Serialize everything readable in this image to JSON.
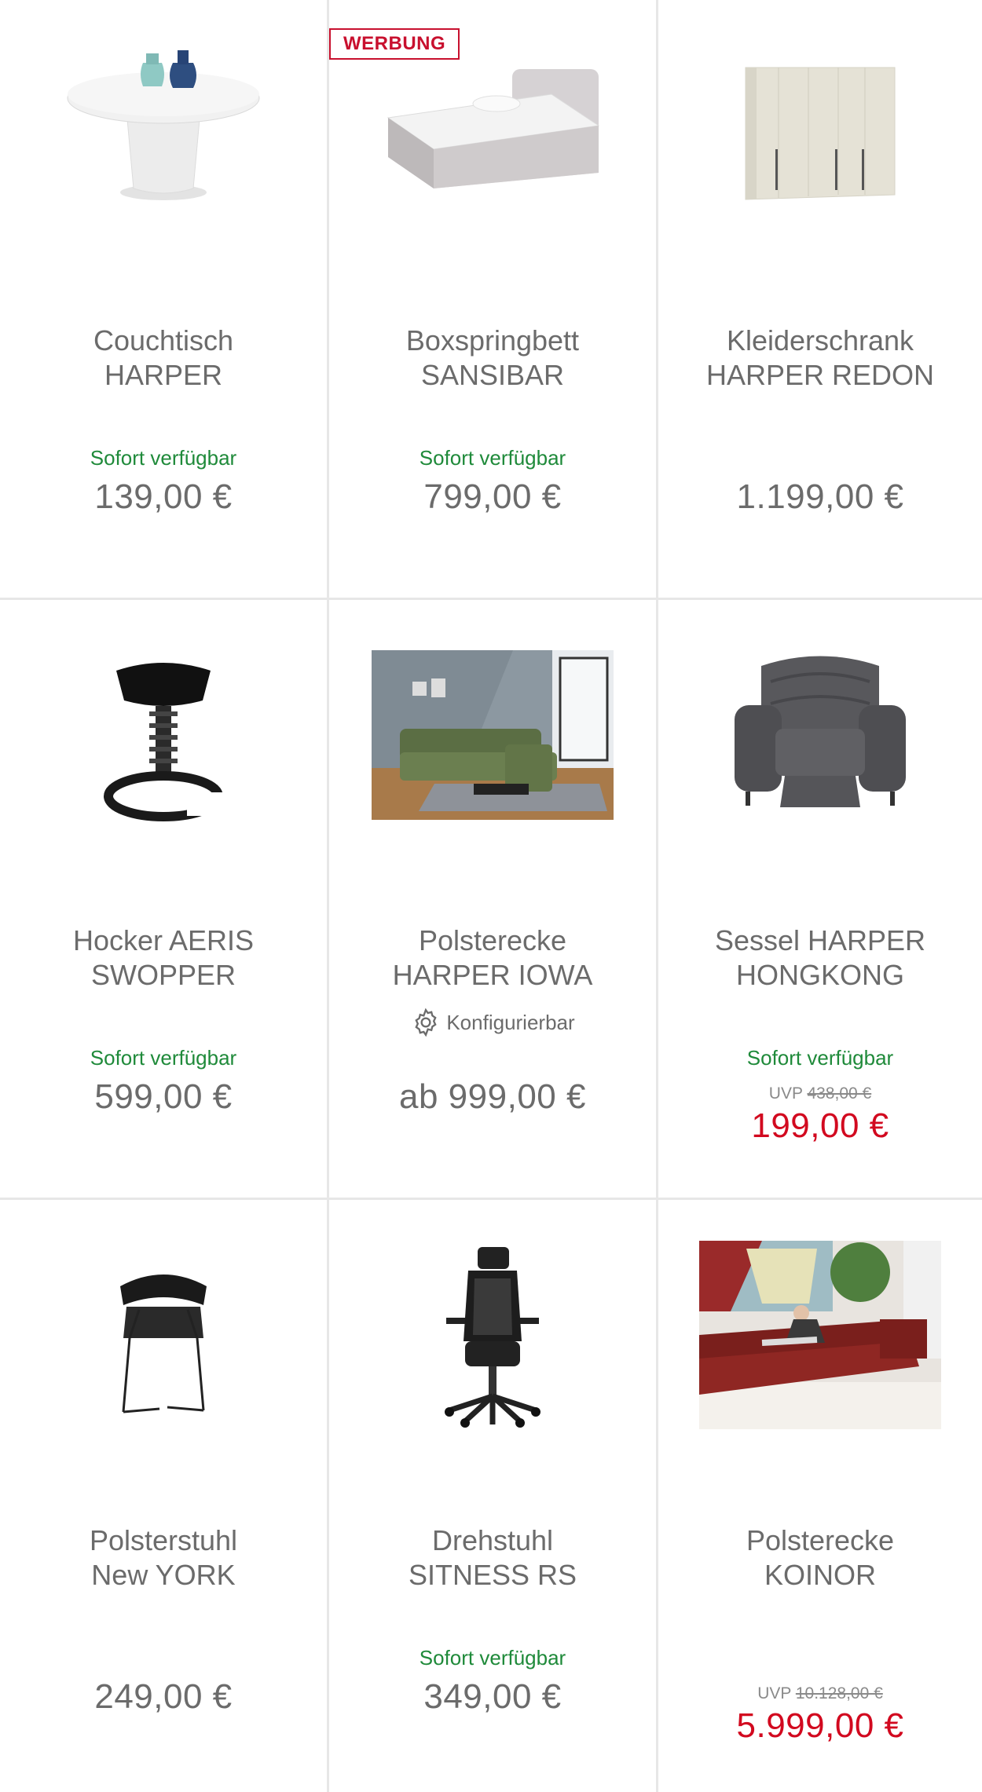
{
  "colors": {
    "available": "#1f8a3a",
    "sale": "#d2091f",
    "text": "#6b6b6b",
    "badge": "#c8102e"
  },
  "products": [
    {
      "title1": "Couchtisch",
      "title2": "HARPER",
      "availability": "Sofort verfügbar",
      "price": "139,00 €"
    },
    {
      "badge": "WERBUNG",
      "title1": "Boxspringbett",
      "title2": "SANSIBAR",
      "availability": "Sofort verfügbar",
      "price": "799,00 €"
    },
    {
      "title1": "Kleiderschrank",
      "title2": "HARPER REDON",
      "price": "1.199,00 €"
    },
    {
      "title1": "Hocker AERIS",
      "title2": "SWOPPER",
      "availability": "Sofort verfügbar",
      "price": "599,00 €"
    },
    {
      "title1": "Polsterecke",
      "title2": "HARPER IOWA",
      "configurable": "Konfigurierbar",
      "config_icon": "gear-icon",
      "price": "ab 999,00 €"
    },
    {
      "title1": "Sessel HARPER",
      "title2": "HONGKONG",
      "availability": "Sofort verfügbar",
      "uvp_label": "UVP",
      "uvp_old": "438,00 €",
      "price": "199,00 €"
    },
    {
      "title1": "Polsterstuhl",
      "title2": "New YORK",
      "price": "249,00 €"
    },
    {
      "title1": "Drehstuhl",
      "title2": "SITNESS RS",
      "availability": "Sofort verfügbar",
      "price": "349,00 €"
    },
    {
      "title1": "Polsterecke",
      "title2": "KOINOR",
      "uvp_label": "UVP",
      "uvp_old": "10.128,00 €",
      "price": "5.999,00 €"
    }
  ]
}
